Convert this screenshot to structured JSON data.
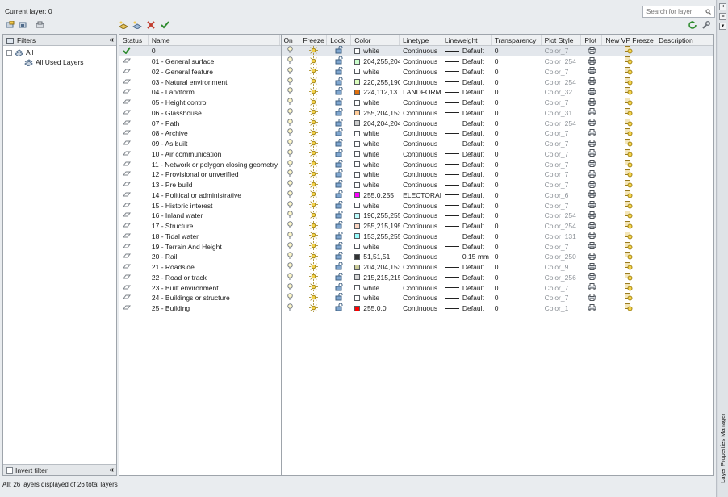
{
  "header": {
    "current_layer": "Current layer: 0",
    "search_placeholder": "Search for layer"
  },
  "filters": {
    "title": "Filters",
    "tree": [
      {
        "label": "All",
        "level": 0
      },
      {
        "label": "All Used Layers",
        "level": 1
      }
    ],
    "invert_filter": "Invert filter"
  },
  "columns": [
    "Status",
    "Name",
    "On",
    "Freeze",
    "Lock",
    "Color",
    "Linetype",
    "Lineweight",
    "Transparency",
    "Plot Style",
    "Plot",
    "New VP Freeze",
    "Description"
  ],
  "layers": [
    {
      "name": "0",
      "color_name": "white",
      "color_hex": "#ffffff",
      "linetype": "Continuous",
      "lineweight": "Default",
      "transparency": "0",
      "plot_style": "Color_7",
      "current": true
    },
    {
      "name": "01 - General surface",
      "color_name": "204,255,204",
      "color_hex": "#ccffcc",
      "linetype": "Continuous",
      "lineweight": "Default",
      "transparency": "0",
      "plot_style": "Color_254"
    },
    {
      "name": "02 - General feature",
      "color_name": "white",
      "color_hex": "#ffffff",
      "linetype": "Continuous",
      "lineweight": "Default",
      "transparency": "0",
      "plot_style": "Color_7"
    },
    {
      "name": "03 - Natural environment",
      "color_name": "220,255,190",
      "color_hex": "#dcffbe",
      "linetype": "Continuous",
      "lineweight": "Default",
      "transparency": "0",
      "plot_style": "Color_254"
    },
    {
      "name": "04 - Landform",
      "color_name": "224,112,13",
      "color_hex": "#e0700d",
      "linetype": "LANDFORM",
      "lineweight": "Default",
      "transparency": "0",
      "plot_style": "Color_32"
    },
    {
      "name": "05 - Height control",
      "color_name": "white",
      "color_hex": "#ffffff",
      "linetype": "Continuous",
      "lineweight": "Default",
      "transparency": "0",
      "plot_style": "Color_7"
    },
    {
      "name": "06 - Glasshouse",
      "color_name": "255,204,153",
      "color_hex": "#ffcc99",
      "linetype": "Continuous",
      "lineweight": "Default",
      "transparency": "0",
      "plot_style": "Color_31"
    },
    {
      "name": "07 - Path",
      "color_name": "204,204,204",
      "color_hex": "#cccccc",
      "linetype": "Continuous",
      "lineweight": "Default",
      "transparency": "0",
      "plot_style": "Color_254"
    },
    {
      "name": "08 - Archive",
      "color_name": "white",
      "color_hex": "#ffffff",
      "linetype": "Continuous",
      "lineweight": "Default",
      "transparency": "0",
      "plot_style": "Color_7"
    },
    {
      "name": "09 - As built",
      "color_name": "white",
      "color_hex": "#ffffff",
      "linetype": "Continuous",
      "lineweight": "Default",
      "transparency": "0",
      "plot_style": "Color_7"
    },
    {
      "name": "10 - Air communication",
      "color_name": "white",
      "color_hex": "#ffffff",
      "linetype": "Continuous",
      "lineweight": "Default",
      "transparency": "0",
      "plot_style": "Color_7"
    },
    {
      "name": "11 - Network or polygon closing geometry",
      "color_name": "white",
      "color_hex": "#ffffff",
      "linetype": "Continuous",
      "lineweight": "Default",
      "transparency": "0",
      "plot_style": "Color_7"
    },
    {
      "name": "12 - Provisional or unverified",
      "color_name": "white",
      "color_hex": "#ffffff",
      "linetype": "Continuous",
      "lineweight": "Default",
      "transparency": "0",
      "plot_style": "Color_7"
    },
    {
      "name": "13 - Pre build",
      "color_name": "white",
      "color_hex": "#ffffff",
      "linetype": "Continuous",
      "lineweight": "Default",
      "transparency": "0",
      "plot_style": "Color_7"
    },
    {
      "name": "14 - Political or administrative",
      "color_name": "255,0,255",
      "color_hex": "#ff00ff",
      "linetype": "ELECTORAL",
      "lineweight": "Default",
      "transparency": "0",
      "plot_style": "Color_6"
    },
    {
      "name": "15 - Historic interest",
      "color_name": "white",
      "color_hex": "#ffffff",
      "linetype": "Continuous",
      "lineweight": "Default",
      "transparency": "0",
      "plot_style": "Color_7"
    },
    {
      "name": "16 - Inland water",
      "color_name": "190,255,255",
      "color_hex": "#beffff",
      "linetype": "Continuous",
      "lineweight": "Default",
      "transparency": "0",
      "plot_style": "Color_254"
    },
    {
      "name": "17 - Structure",
      "color_name": "255,215,195",
      "color_hex": "#ffd7c3",
      "linetype": "Continuous",
      "lineweight": "Default",
      "transparency": "0",
      "plot_style": "Color_254"
    },
    {
      "name": "18 - Tidal water",
      "color_name": "153,255,255",
      "color_hex": "#99ffff",
      "linetype": "Continuous",
      "lineweight": "Default",
      "transparency": "0",
      "plot_style": "Color_131"
    },
    {
      "name": "19 - Terrain And Height",
      "color_name": "white",
      "color_hex": "#ffffff",
      "linetype": "Continuous",
      "lineweight": "Default",
      "transparency": "0",
      "plot_style": "Color_7"
    },
    {
      "name": "20 - Rail",
      "color_name": "51,51,51",
      "color_hex": "#333333",
      "linetype": "Continuous",
      "lineweight": "0.15 mm",
      "transparency": "0",
      "plot_style": "Color_250"
    },
    {
      "name": "21 - Roadside",
      "color_name": "204,204,153",
      "color_hex": "#cccc99",
      "linetype": "Continuous",
      "lineweight": "Default",
      "transparency": "0",
      "plot_style": "Color_9"
    },
    {
      "name": "22 - Road or track",
      "color_name": "215,215,215",
      "color_hex": "#d7d7d7",
      "linetype": "Continuous",
      "lineweight": "Default",
      "transparency": "0",
      "plot_style": "Color_256"
    },
    {
      "name": "23 - Built environment",
      "color_name": "white",
      "color_hex": "#ffffff",
      "linetype": "Continuous",
      "lineweight": "Default",
      "transparency": "0",
      "plot_style": "Color_7"
    },
    {
      "name": "24 - Buildings or structure",
      "color_name": "white",
      "color_hex": "#ffffff",
      "linetype": "Continuous",
      "lineweight": "Default",
      "transparency": "0",
      "plot_style": "Color_7"
    },
    {
      "name": "25 - Building",
      "color_name": "255,0,0",
      "color_hex": "#ff0000",
      "linetype": "Continuous",
      "lineweight": "Default",
      "transparency": "0",
      "plot_style": "Color_1"
    }
  ],
  "status_bar": "All: 26 layers displayed of 26 total layers",
  "side_title": "Layer Properties Manager"
}
